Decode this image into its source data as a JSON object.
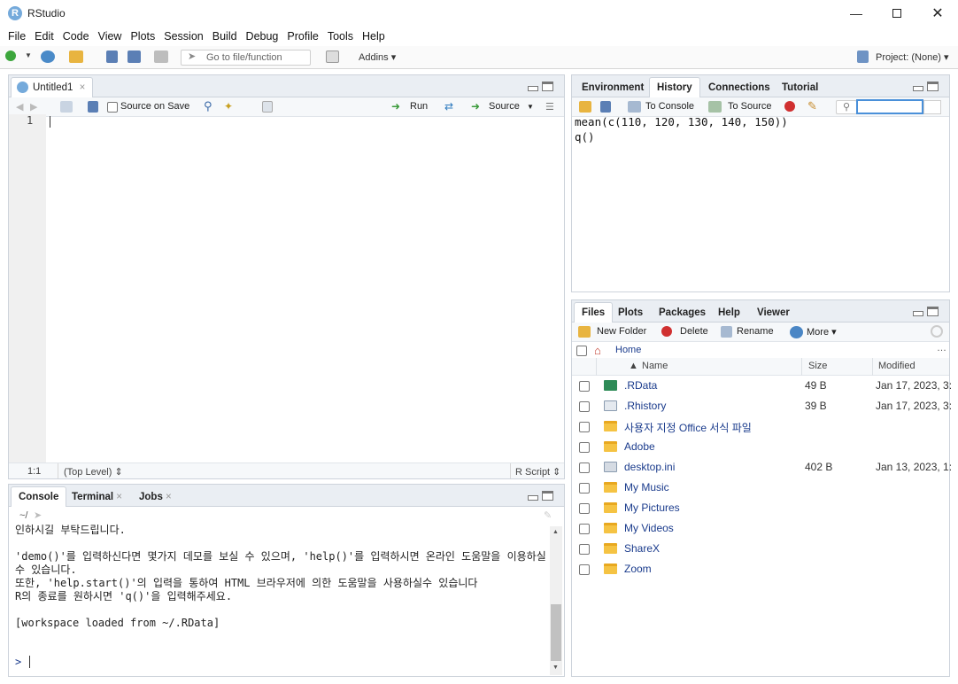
{
  "window": {
    "title": "RStudio",
    "logo_letter": "R"
  },
  "menu": [
    "File",
    "Edit",
    "Code",
    "View",
    "Plots",
    "Session",
    "Build",
    "Debug",
    "Profile",
    "Tools",
    "Help"
  ],
  "toolbar": {
    "goto_placeholder": "Go to file/function",
    "addins_label": "Addins",
    "project_label": "Project: (None)"
  },
  "source": {
    "tab_label": "Untitled1",
    "source_on_save_label": "Source on Save",
    "run_label": "Run",
    "source_label": "Source",
    "line_number": "1",
    "status_position": "1:1",
    "status_scope": "(Top Level)",
    "status_type": "R Script"
  },
  "console_pane": {
    "tabs": [
      "Console",
      "Terminal",
      "Jobs"
    ],
    "path": "~/",
    "text": "인하시길 부탁드립니다.\n\n'demo()'를 입력하신다면 몇가지 데모를 보실 수 있으며, 'help()'를 입력하시면 온라인 도움말을 이용하실 수 있습니다.\n또한, 'help.start()'의 입력을 통하여 HTML 브라우저에 의한 도움말을 사용하실수 있습니다\nR의 종료를 원하시면 'q()'을 입력해주세요.\n\n[workspace loaded from ~/.RData]\n",
    "prompt": ">"
  },
  "env_pane": {
    "tabs": [
      "Environment",
      "History",
      "Connections",
      "Tutorial"
    ],
    "to_console_label": "To Console",
    "to_source_label": "To Source",
    "history": [
      "mean(c(110, 120, 130, 140, 150))",
      "q()"
    ]
  },
  "files_pane": {
    "tabs": [
      "Files",
      "Plots",
      "Packages",
      "Help",
      "Viewer"
    ],
    "new_folder_label": "New Folder",
    "delete_label": "Delete",
    "rename_label": "Rename",
    "more_label": "More",
    "breadcrumb": "Home",
    "columns": {
      "name": "Name",
      "size": "Size",
      "modified": "Modified"
    },
    "files": [
      {
        "name": ".RData",
        "size": "49 B",
        "modified": "Jan 17, 2023, 3:",
        "icon": "rdata-icon"
      },
      {
        "name": ".Rhistory",
        "size": "39 B",
        "modified": "Jan 17, 2023, 3:",
        "icon": "rhistory-icon"
      },
      {
        "name": "사용자 지정 Office 서식 파일",
        "size": "",
        "modified": "",
        "icon": "folder-icon"
      },
      {
        "name": "Adobe",
        "size": "",
        "modified": "",
        "icon": "folder-icon"
      },
      {
        "name": "desktop.ini",
        "size": "402 B",
        "modified": "Jan 13, 2023, 1:",
        "icon": "ini-file-icon"
      },
      {
        "name": "My Music",
        "size": "",
        "modified": "",
        "icon": "folder-icon"
      },
      {
        "name": "My Pictures",
        "size": "",
        "modified": "",
        "icon": "folder-icon"
      },
      {
        "name": "My Videos",
        "size": "",
        "modified": "",
        "icon": "folder-icon"
      },
      {
        "name": "ShareX",
        "size": "",
        "modified": "",
        "icon": "folder-icon"
      },
      {
        "name": "Zoom",
        "size": "",
        "modified": "",
        "icon": "folder-icon"
      }
    ]
  }
}
